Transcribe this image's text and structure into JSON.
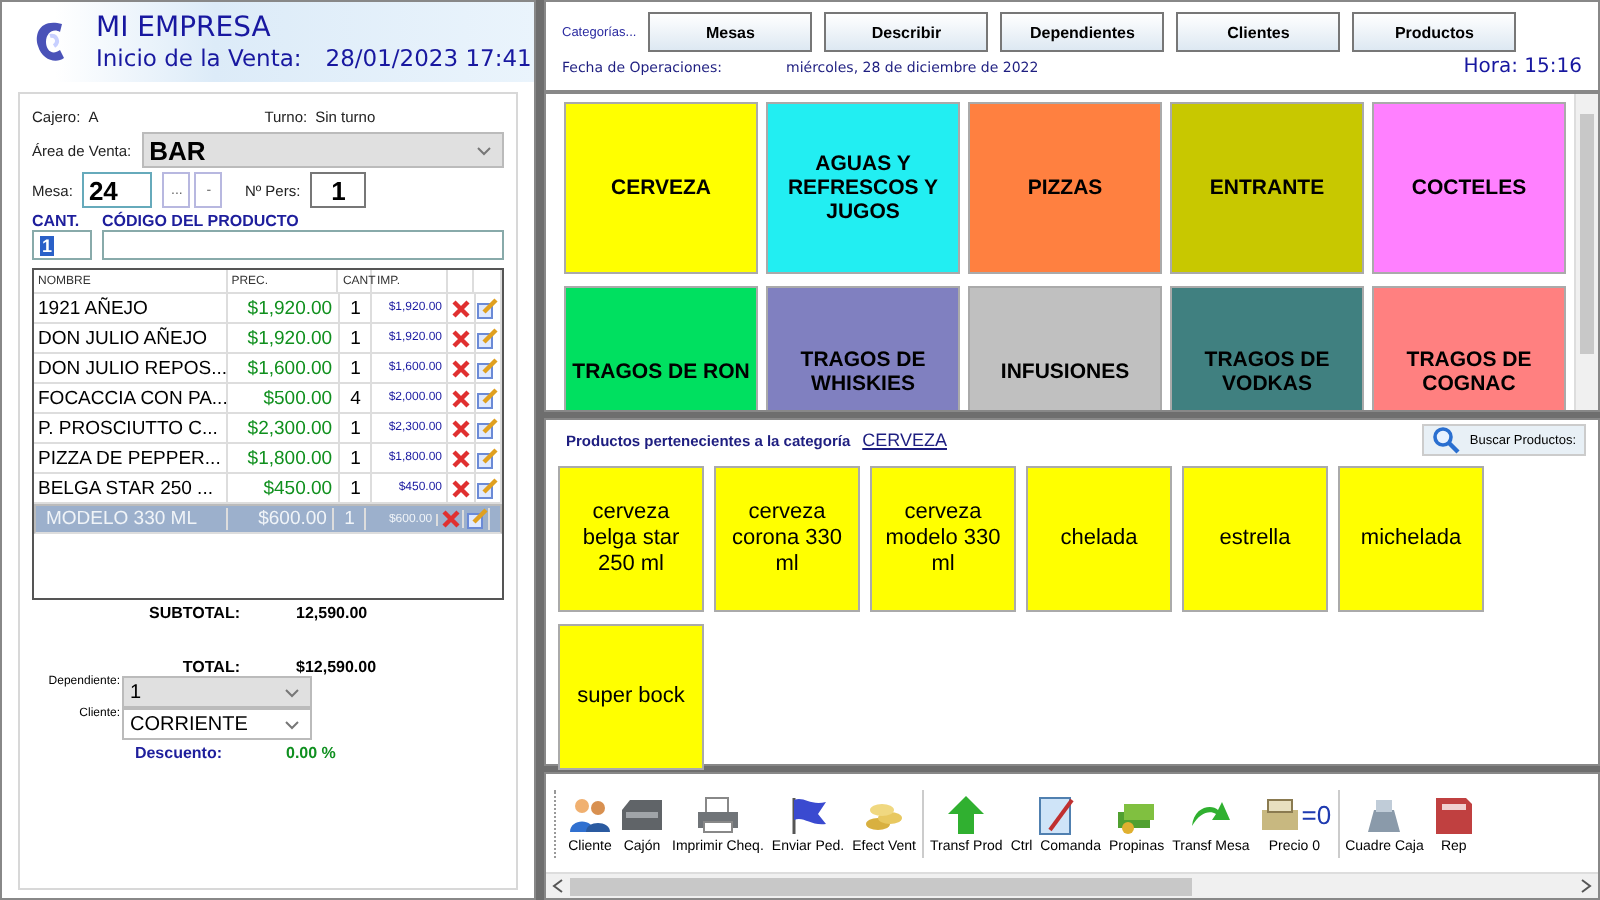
{
  "header": {
    "title": "MI EMPRESA",
    "subtitle_label": "Inicio de la Venta:",
    "subtitle_value": "28/01/2023 17:41"
  },
  "order": {
    "cashier_label": "Cajero:",
    "cashier": "A",
    "shift_label": "Turno:",
    "shift": "Sin turno",
    "area_label": "Área de Venta:",
    "area": "BAR",
    "table_label": "Mesa:",
    "table": "24",
    "table_buttons": [
      "...",
      "-"
    ],
    "people_label": "Nº Pers:",
    "people": "1",
    "qty_label": "CANT.",
    "code_label": "CÓDIGO DEL PRODUCTO",
    "qty": "1",
    "columns": [
      "NOMBRE",
      "PREC.",
      "CANT",
      "IMP."
    ],
    "rows": [
      {
        "name": "1921 AÑEJO",
        "price": "$1,920.00",
        "qty": "1",
        "amount": "$1,920.00",
        "selected": false
      },
      {
        "name": "DON JULIO AÑEJO",
        "price": "$1,920.00",
        "qty": "1",
        "amount": "$1,920.00",
        "selected": false
      },
      {
        "name": "DON JULIO REPOS...",
        "price": "$1,600.00",
        "qty": "1",
        "amount": "$1,600.00",
        "selected": false
      },
      {
        "name": "FOCACCIA CON PA...",
        "price": "$500.00",
        "qty": "4",
        "amount": "$2,000.00",
        "selected": false
      },
      {
        "name": "P. PROSCIUTTO C...",
        "price": "$2,300.00",
        "qty": "1",
        "amount": "$2,300.00",
        "selected": false
      },
      {
        "name": "PIZZA DE PEPPER...",
        "price": "$1,800.00",
        "qty": "1",
        "amount": "$1,800.00",
        "selected": false
      },
      {
        "name": "BELGA STAR 250 ...",
        "price": "$450.00",
        "qty": "1",
        "amount": "$450.00",
        "selected": false
      },
      {
        "name": "MODELO 330 ML",
        "price": "$600.00",
        "qty": "1",
        "amount": "$600.00",
        "selected": true
      }
    ],
    "subtotal_label": "SUBTOTAL:",
    "subtotal": "12,590.00",
    "total_label": "TOTAL:",
    "total": "$12,590.00",
    "waiter_label": "Dependiente:",
    "waiter": "1",
    "client_label": "Cliente:",
    "client": "CORRIENTE",
    "discount_label": "Descuento:",
    "discount": "0.00 %"
  },
  "top": {
    "categories_label": "Categorías...",
    "buttons": [
      "Mesas",
      "Describir",
      "Dependientes",
      "Clientes",
      "Productos"
    ],
    "date_label": "Fecha de Operaciones:",
    "date": "miércoles, 28 de diciembre de 2022",
    "time": "Hora: 15:16"
  },
  "categories": [
    {
      "label": "CERVEZA",
      "color": "#ffff00"
    },
    {
      "label": "AGUAS Y REFRESCOS Y JUGOS",
      "color": "#22eef2"
    },
    {
      "label": "PIZZAS",
      "color": "#ff8040"
    },
    {
      "label": "ENTRANTE",
      "color": "#c8c800"
    },
    {
      "label": "COCTELES",
      "color": "#ff80ff"
    },
    {
      "label": "TRAGOS DE RON",
      "color": "#00e060"
    },
    {
      "label": "TRAGOS DE WHISKIES",
      "color": "#8080c0"
    },
    {
      "label": "INFUSIONES",
      "color": "#c0c0c0"
    },
    {
      "label": "TRAGOS DE VODKAS",
      "color": "#408080"
    },
    {
      "label": "TRAGOS DE COGNAC",
      "color": "#ff8080"
    }
  ],
  "products": {
    "title": "Productos pertenecientes a la categoría",
    "category": "CERVEZA",
    "search_button": "Buscar Productos:",
    "items": [
      {
        "label": "cerveza belga star 250 ml"
      },
      {
        "label": "cerveza corona 330 ml"
      },
      {
        "label": "cerveza modelo 330 ml"
      },
      {
        "label": "chelada"
      },
      {
        "label": "estrella"
      },
      {
        "label": "michelada"
      },
      {
        "label": "super bock"
      }
    ]
  },
  "toolbar": [
    {
      "label": "Cliente",
      "kind": "people"
    },
    {
      "label": "Cajón",
      "kind": "drawer"
    },
    {
      "label": "Imprimir Cheq.",
      "kind": "printer"
    },
    {
      "label": "Enviar Ped.",
      "kind": "flag"
    },
    {
      "label": "Efect Vent",
      "kind": "coins"
    },
    {
      "label": "Transf Prod",
      "kind": "uparrow",
      "separator": true
    },
    {
      "label": "Ctrl  Comanda",
      "kind": "notepad"
    },
    {
      "label": "Propinas",
      "kind": "money"
    },
    {
      "label": "Transf Mesa",
      "kind": "turnarrow"
    },
    {
      "label": "Precio 0",
      "kind": "register",
      "badge": "=0"
    },
    {
      "label": "Cuadre Caja",
      "kind": "calculator",
      "separator": true
    },
    {
      "label": "Rep",
      "kind": "book"
    }
  ]
}
